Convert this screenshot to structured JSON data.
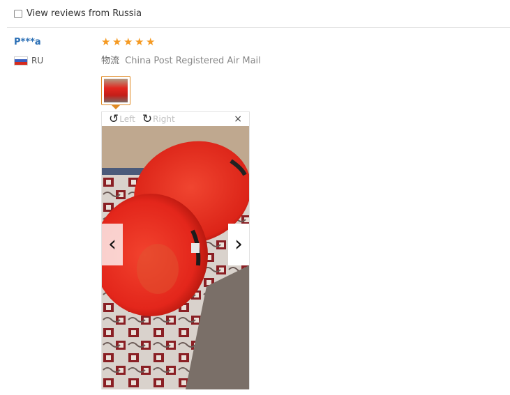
{
  "filter": {
    "label": "View reviews from Russia",
    "checked": false
  },
  "review": {
    "user_name": "P***a",
    "country": "RU",
    "rating": 5,
    "shipping_label": "物流",
    "shipping_method": "China Post Registered Air Mail"
  },
  "viewer": {
    "rotate_left": "Left",
    "rotate_right": "Right",
    "close_glyph": "×",
    "prev_glyph": "‹",
    "next_glyph": "›"
  },
  "colors": {
    "star": "#f59a23",
    "link": "#2b6fb5",
    "accent": "#e08a24"
  }
}
